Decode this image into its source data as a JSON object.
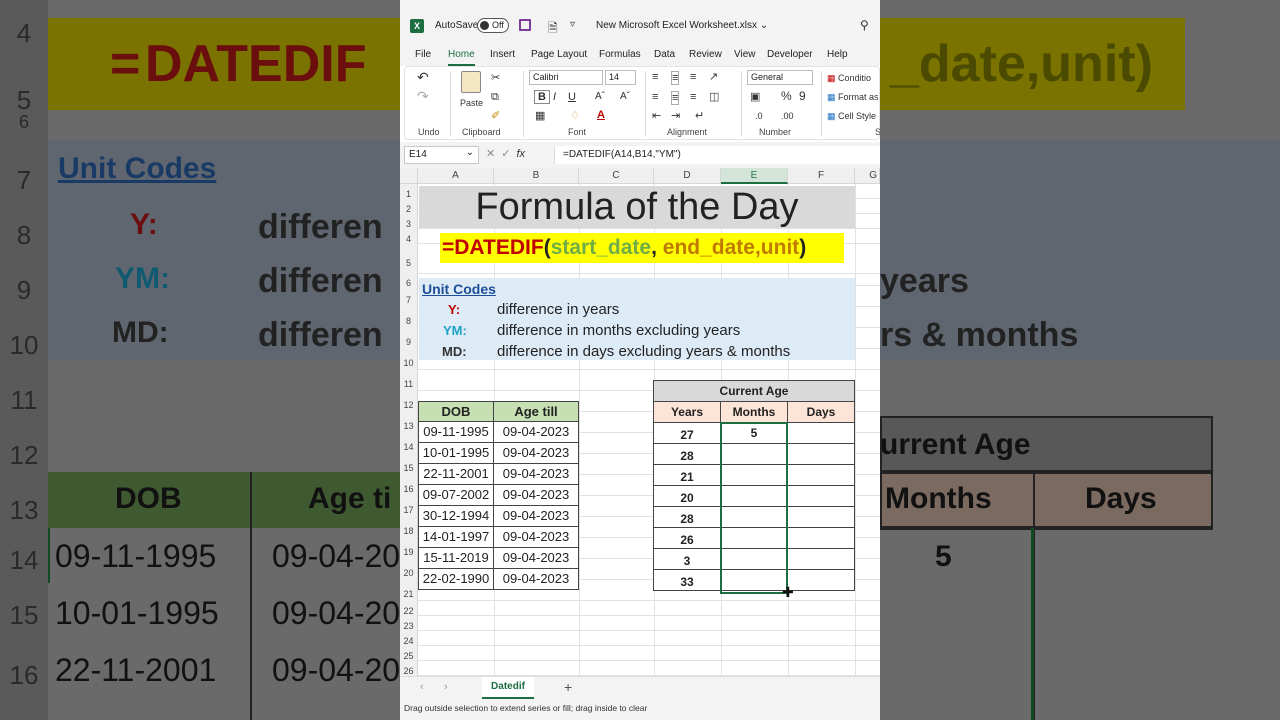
{
  "window": {
    "autosave_label": "AutoSave",
    "autosave_state": "Off",
    "file_name": "New Microsoft Excel Worksheet.xlsx",
    "app_logo": "X"
  },
  "menu": [
    "File",
    "Home",
    "Insert",
    "Page Layout",
    "Formulas",
    "Data",
    "Review",
    "View",
    "Developer",
    "Help"
  ],
  "ribbon": {
    "undo_label": "Undo",
    "clipboard_label": "Clipboard",
    "paste_label": "Paste",
    "font_label": "Font",
    "font_name": "Calibri",
    "font_size": "14",
    "alignment_label": "Alignment",
    "number_label": "Number",
    "number_format": "General",
    "styles_items": [
      "Conditio",
      "Format as",
      "Cell Style"
    ],
    "cut_letter": "S"
  },
  "formula_bar": {
    "name_box": "E14",
    "fx_label": "fx",
    "formula": "=DATEDIF(A14,B14,\"YM\")"
  },
  "columns": [
    "A",
    "B",
    "C",
    "D",
    "E",
    "F",
    "G"
  ],
  "rows": [
    "1",
    "2",
    "3",
    "4",
    "5",
    "6",
    "7",
    "8",
    "9",
    "10",
    "11",
    "12",
    "13",
    "14",
    "15",
    "16",
    "17",
    "18",
    "19",
    "20",
    "21",
    "22",
    "23",
    "24",
    "25",
    "26"
  ],
  "sheet": {
    "title": "Formula of the Day",
    "datedif_eq": "=",
    "datedif_fn": "DATEDIF",
    "datedif_open": "(",
    "datedif_arg1": "start_date",
    "datedif_comma1": ", ",
    "datedif_arg2": "end_date,unit",
    "datedif_close": ")",
    "unit_codes_heading": "Unit Codes",
    "codes": [
      {
        "code": "Y:",
        "desc": "difference in years",
        "color": "#c00000"
      },
      {
        "code": "YM:",
        "desc": "difference in months excluding years",
        "color": "#1fa3c7"
      },
      {
        "code": "MD:",
        "desc": "difference in days excluding years & months",
        "color": "#333333"
      }
    ],
    "dob_header": "DOB",
    "age_till_header": "Age till",
    "dob": [
      "09-11-1995",
      "10-01-1995",
      "22-11-2001",
      "09-07-2002",
      "30-12-1994",
      "14-01-1997",
      "15-11-2019",
      "22-02-1990"
    ],
    "age_till": [
      "09-04-2023",
      "09-04-2023",
      "09-04-2023",
      "09-04-2023",
      "09-04-2023",
      "09-04-2023",
      "09-04-2023",
      "09-04-2023"
    ],
    "current_age_header": "Current Age",
    "years_header": "Years",
    "months_header": "Months",
    "days_header": "Days",
    "years": [
      "27",
      "28",
      "21",
      "20",
      "28",
      "26",
      "3",
      "33"
    ],
    "months": [
      "5",
      "",
      "",
      "",
      "",
      "",
      "",
      ""
    ],
    "days": [
      "",
      "",
      "",
      "",
      "",
      "",
      "",
      ""
    ]
  },
  "sheet_tabs": {
    "active": "Datedif",
    "add": "+"
  },
  "status_text": "Drag outside selection to extend series or fill; drag inside to clear",
  "colors": {
    "excel_green": "#1d6f42",
    "title_bg": "#d9d9d9",
    "formula_bg": "#ffff00",
    "codes_bg": "#ddebf7",
    "table_header_green": "#c6e0b4",
    "age_header_gray": "#d9d9d9",
    "age_subheader_peach": "#fce4d6",
    "arg1_color": "#70ad47",
    "arg2_color": "#c07a00"
  }
}
